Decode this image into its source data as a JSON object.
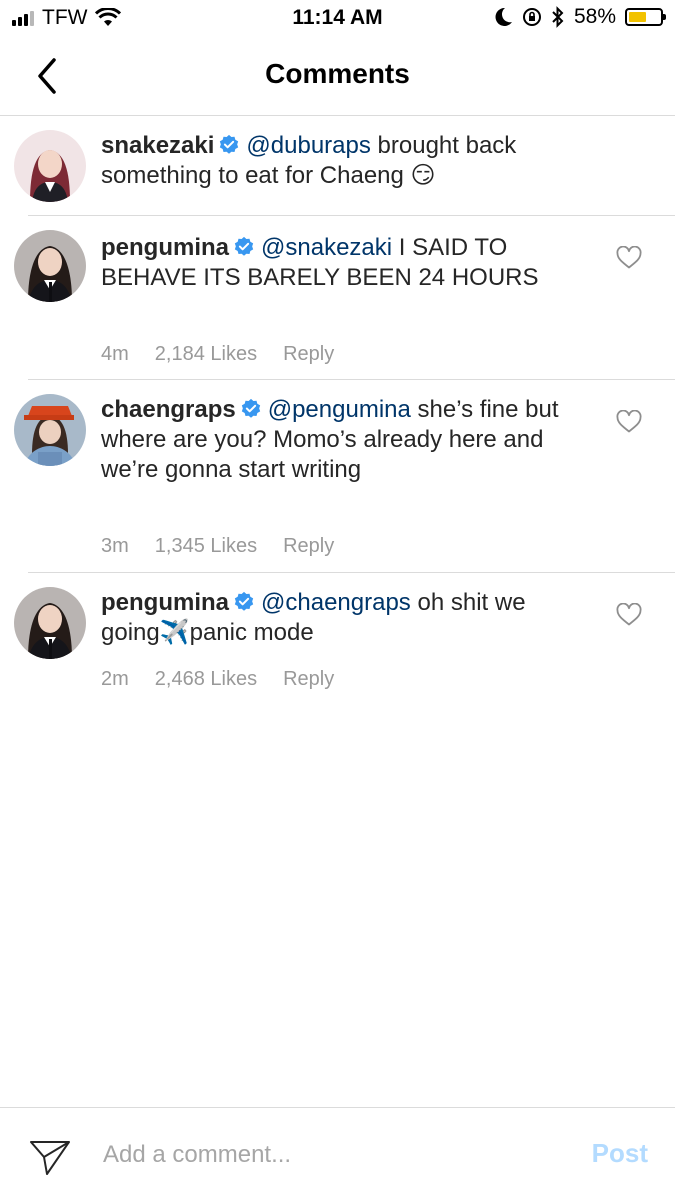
{
  "status_bar": {
    "carrier": "TFW",
    "time": "11:14 AM",
    "battery_percent": "58%",
    "battery_level": 0.58,
    "battery_color": "#f2c200",
    "icons": [
      "signal-icon",
      "wifi-icon",
      "moon-icon",
      "rotation-lock-icon",
      "bluetooth-icon",
      "battery-icon"
    ]
  },
  "nav": {
    "title": "Comments",
    "back_icon": "chevron-left-icon"
  },
  "comments": [
    {
      "username": "snakezaki",
      "verified": true,
      "mention": "@duburaps",
      "text": " brought back something to eat for Chaeng 😏",
      "time": "",
      "likes": "",
      "reply": ""
    },
    {
      "username": "pengumina",
      "verified": true,
      "mention": "@snakezaki",
      "text": " I SAID TO BEHAVE ITS BARELY BEEN 24 HOURS",
      "time": "4m",
      "likes": "2,184 Likes",
      "reply": "Reply"
    },
    {
      "username": "chaengraps",
      "verified": true,
      "mention": "@pengumina",
      "text": " she’s fine but where are you? Momo’s already here and we’re gonna start writing",
      "time": "3m",
      "likes": "1,345 Likes",
      "reply": "Reply"
    },
    {
      "username": "pengumina",
      "verified": true,
      "mention": "@chaengraps",
      "text": " oh shit we going✈️panic mode",
      "time": "2m",
      "likes": "2,468 Likes",
      "reply": "Reply"
    }
  ],
  "composer": {
    "placeholder": "Add a comment...",
    "post_label": "Post",
    "post_color": "#b3dbff"
  },
  "colors": {
    "mention": "#003569",
    "verified": "#3897f0",
    "meta": "#999999",
    "divider": "#dbdbdb"
  }
}
